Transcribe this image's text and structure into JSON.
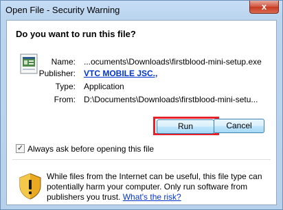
{
  "window": {
    "title": "Open File - Security Warning",
    "close_glyph": "x"
  },
  "dialog": {
    "heading": "Do you want to run this file?",
    "file_icon": "application-file-icon",
    "fields": {
      "name_label": "Name:",
      "name_value": "...ocuments\\Downloads\\firstblood-mini-setup.exe",
      "publisher_label": "Publisher:",
      "publisher_value": "VTC MOBILE JSC.,",
      "type_label": "Type:",
      "type_value": "Application",
      "from_label": "From:",
      "from_value": "D:\\Documents\\Downloads\\firstblood-mini-setu..."
    },
    "buttons": {
      "run": "Run",
      "cancel": "Cancel"
    },
    "checkbox": {
      "label": "Always ask before opening this file",
      "checked": true,
      "glyph": "✓"
    },
    "warning": {
      "icon": "shield-warning-icon",
      "text": "While files from the Internet can be useful, this file type can potentially harm your computer. Only run software from publishers you trust.",
      "link": "What's the risk?"
    },
    "highlight_color": "#e8202a"
  }
}
